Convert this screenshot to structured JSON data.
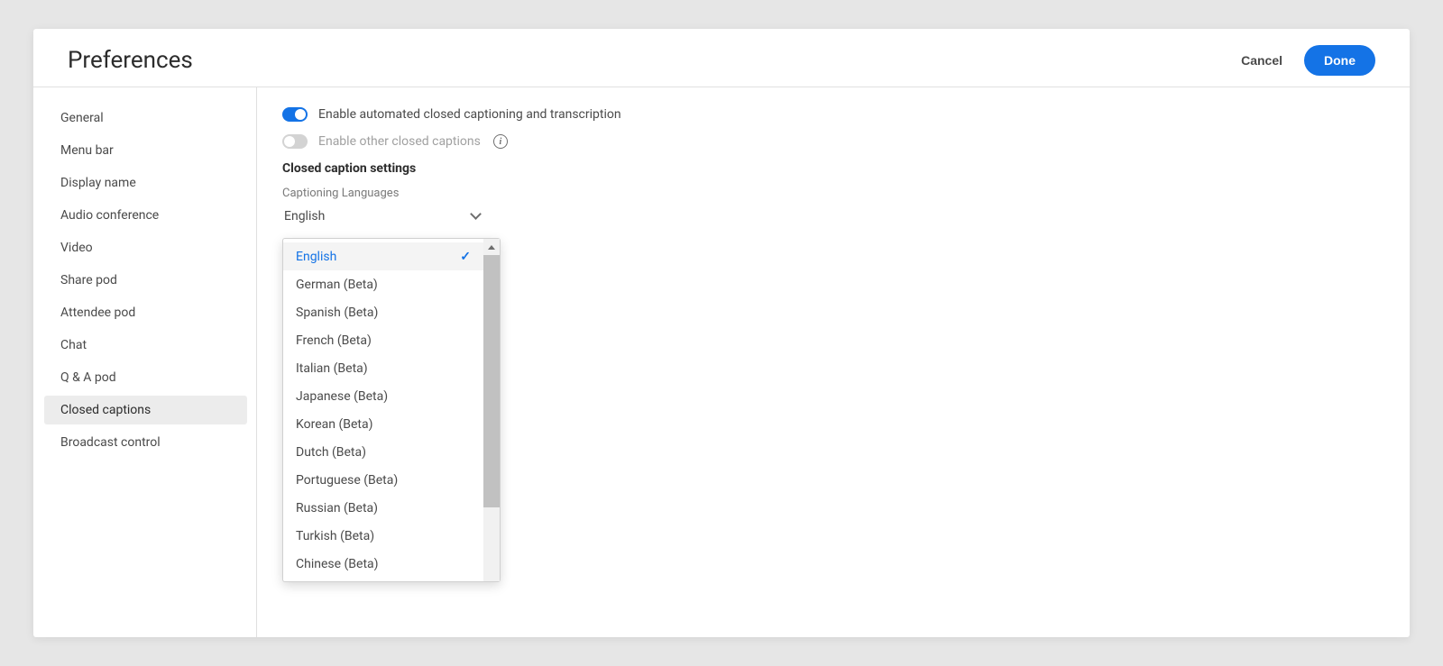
{
  "header": {
    "title": "Preferences",
    "cancel_label": "Cancel",
    "done_label": "Done"
  },
  "sidebar": {
    "items": [
      {
        "label": "General"
      },
      {
        "label": "Menu bar"
      },
      {
        "label": "Display name"
      },
      {
        "label": "Audio conference"
      },
      {
        "label": "Video"
      },
      {
        "label": "Share pod"
      },
      {
        "label": "Attendee pod"
      },
      {
        "label": "Chat"
      },
      {
        "label": "Q & A pod"
      },
      {
        "label": "Closed captions"
      },
      {
        "label": "Broadcast control"
      }
    ],
    "selected_index": 9
  },
  "content": {
    "toggle1_label": "Enable automated closed captioning and transcription",
    "toggle2_label": "Enable other closed captions",
    "section_heading": "Closed caption settings",
    "field_label": "Captioning Languages",
    "selected_language": "English",
    "languages": [
      {
        "label": "English",
        "selected": true
      },
      {
        "label": "German (Beta)"
      },
      {
        "label": "Spanish (Beta)"
      },
      {
        "label": "French (Beta)"
      },
      {
        "label": "Italian (Beta)"
      },
      {
        "label": "Japanese (Beta)"
      },
      {
        "label": "Korean (Beta)"
      },
      {
        "label": "Dutch (Beta)"
      },
      {
        "label": "Portuguese (Beta)"
      },
      {
        "label": "Russian (Beta)"
      },
      {
        "label": "Turkish (Beta)"
      },
      {
        "label": "Chinese (Beta)"
      }
    ]
  }
}
